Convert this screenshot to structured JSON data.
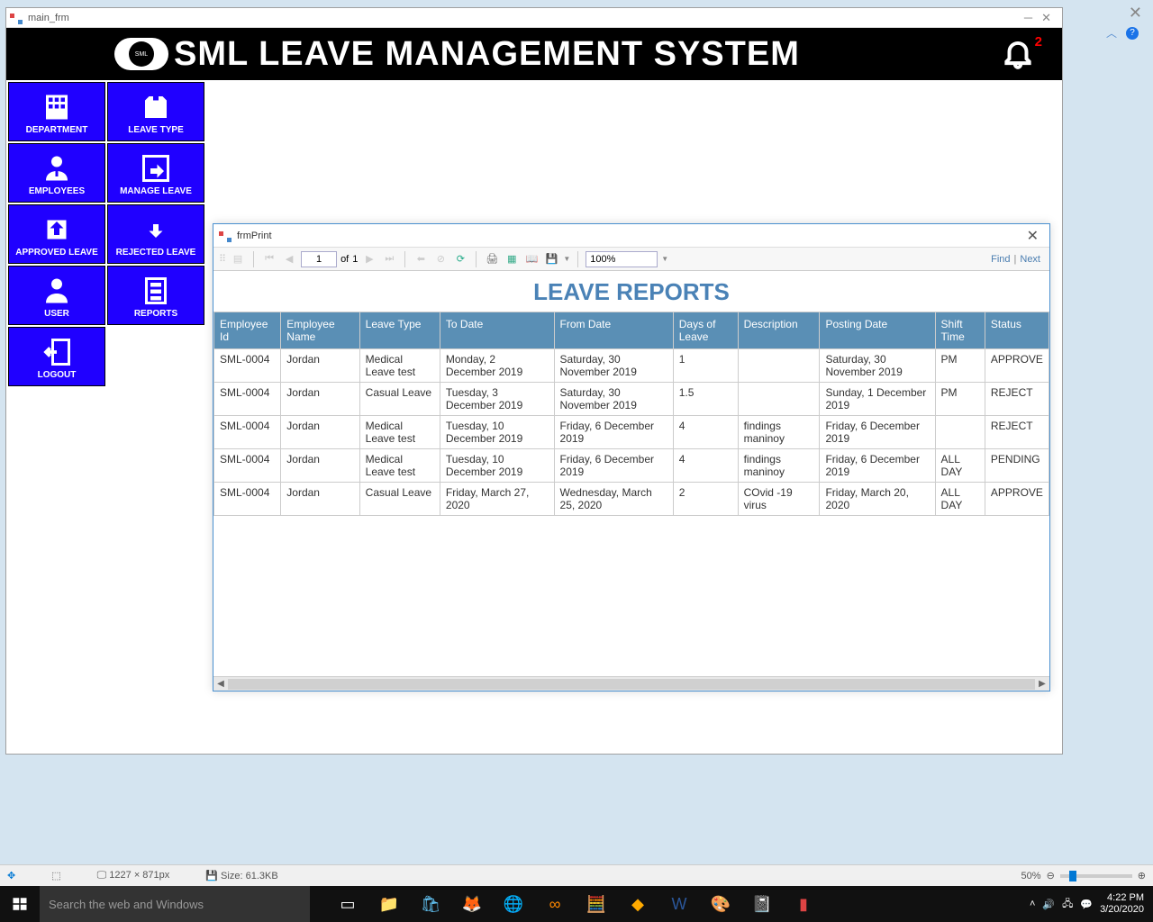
{
  "main_window": {
    "title": "main_frm"
  },
  "header": {
    "app_title": "SML LEAVE MANAGEMENT SYSTEM",
    "logo_text": "SML",
    "notif_count": "2"
  },
  "sidebar": {
    "items": [
      {
        "label": "DEPARTMENT",
        "name": "department"
      },
      {
        "label": "LEAVE TYPE",
        "name": "leave-type"
      },
      {
        "label": "EMPLOYEES",
        "name": "employees"
      },
      {
        "label": "MANAGE LEAVE",
        "name": "manage-leave"
      },
      {
        "label": "APPROVED LEAVE",
        "name": "approved-leave"
      },
      {
        "label": "REJECTED LEAVE",
        "name": "rejected-leave"
      },
      {
        "label": "USER",
        "name": "user"
      },
      {
        "label": "REPORTS",
        "name": "reports"
      },
      {
        "label": "LOGOUT",
        "name": "logout"
      }
    ]
  },
  "modal": {
    "title": "frmPrint",
    "page_current": "1",
    "page_of_label": "of",
    "page_total": "1",
    "zoom": "100%",
    "find_label": "Find",
    "next_label": "Next"
  },
  "report": {
    "title": "LEAVE REPORTS",
    "columns": [
      "Employee Id",
      "Employee Name",
      "Leave Type",
      "To Date",
      "From Date",
      "Days of Leave",
      "Description",
      "Posting Date",
      "Shift Time",
      "Status"
    ],
    "rows": [
      [
        "SML-0004",
        "Jordan",
        "Medical Leave test",
        "Monday, 2 December 2019",
        "Saturday, 30 November 2019",
        "1",
        "",
        "Saturday, 30 November 2019",
        "PM",
        "APPROVE"
      ],
      [
        "SML-0004",
        "Jordan",
        "Casual Leave",
        "Tuesday, 3 December 2019",
        "Saturday, 30 November 2019",
        "1.5",
        "",
        "Sunday, 1 December 2019",
        "PM",
        "REJECT"
      ],
      [
        "SML-0004",
        "Jordan",
        "Medical Leave test",
        "Tuesday, 10 December 2019",
        "Friday, 6 December 2019",
        "4",
        "findings maninoy",
        "Friday, 6 December 2019",
        "",
        "REJECT"
      ],
      [
        "SML-0004",
        "Jordan",
        "Medical Leave test",
        "Tuesday, 10 December 2019",
        "Friday, 6 December 2019",
        "4",
        "findings maninoy",
        "Friday, 6 December 2019",
        "ALL DAY",
        "PENDING"
      ],
      [
        "SML-0004",
        "Jordan",
        "Casual Leave",
        "Friday, March 27, 2020",
        "Wednesday, March 25, 2020",
        "2",
        "COvid -19 virus",
        "Friday, March 20, 2020",
        "ALL DAY",
        "APPROVE"
      ]
    ]
  },
  "statusbar": {
    "dimensions": "1227 × 871px",
    "size_label": "Size:",
    "size": "61.3KB",
    "zoom_pct": "50%"
  },
  "taskbar": {
    "search_placeholder": "Search the web and Windows",
    "time": "4:22 PM",
    "date": "3/20/2020"
  }
}
